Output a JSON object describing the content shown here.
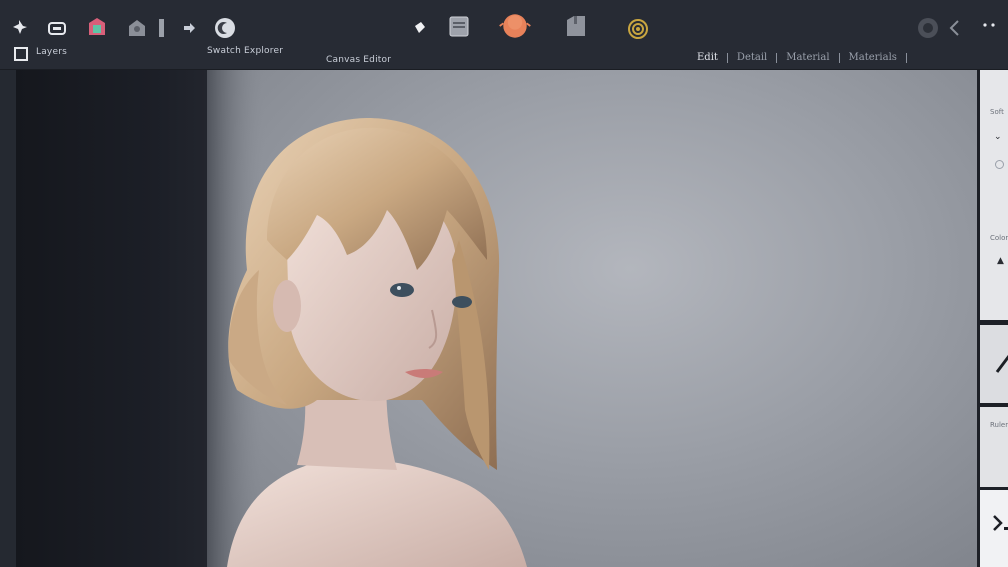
{
  "toolbar": {
    "left_label": "Layers",
    "label_2": "Swatch Explorer",
    "label_3": "Canvas Editor",
    "icons": [
      "move-icon",
      "layer-icon",
      "shape-icon",
      "home-icon",
      "slider-icon",
      "arrow-icon",
      "moon-icon",
      "diamond-icon",
      "layers-panel-icon",
      "color-swatch-icon",
      "document-icon",
      "spiral-icon",
      "settings-icon",
      "chevron-icon",
      "more-icon"
    ],
    "swatch_color": "#e8825a"
  },
  "tabs": [
    {
      "label": "Edit",
      "active": true
    },
    {
      "label": "Detail",
      "active": false
    },
    {
      "label": "Material",
      "active": false
    },
    {
      "label": "Materials",
      "active": false
    }
  ],
  "right_panel": {
    "label_1": "Soft",
    "label_2": "Color",
    "label_3": "Ruler"
  }
}
